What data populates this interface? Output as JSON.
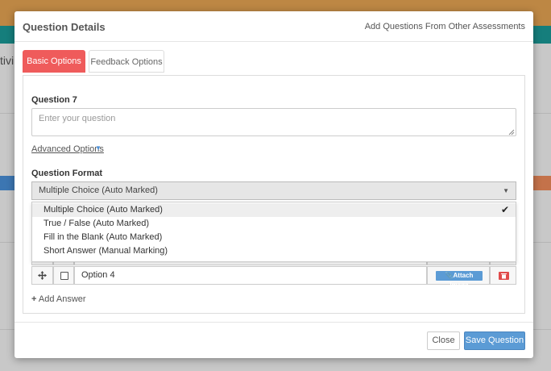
{
  "background": {
    "partial_text": "tivi"
  },
  "modal": {
    "title": "Question Details",
    "header_link": "Add Questions From Other Assessments",
    "tabs": [
      {
        "label": "Basic Options",
        "active": true
      },
      {
        "label": "Feedback Options",
        "active": false
      }
    ],
    "question_label": "Question 7",
    "question_placeholder": "Enter your question",
    "advanced_options": "Advanced Options",
    "format_label": "Question Format",
    "format_selected": "Multiple Choice (Auto Marked)",
    "format_options": [
      {
        "label": "Multiple Choice (Auto Marked)",
        "selected": true
      },
      {
        "label": "True / False (Auto Marked)",
        "selected": false
      },
      {
        "label": "Fill in the Blank (Auto Marked)",
        "selected": false
      },
      {
        "label": "Short Answer (Manual Marking)",
        "selected": false
      }
    ],
    "answers": [
      {
        "text": "Option 4",
        "attach_label": "Attach Image"
      }
    ],
    "add_answer": "Add Answer",
    "close_label": "Close",
    "save_label": "Save Question"
  },
  "colors": {
    "accent_red": "#ef5b5b",
    "primary_blue": "#5b9bd5",
    "topbar_orange": "#e7a553",
    "topbar_teal": "#1a9a98"
  },
  "icons": {
    "move": "move-icon",
    "check": "checkmark-icon",
    "caret": "caret-down-icon",
    "paperclip": "paperclip-icon",
    "trash": "trash-icon",
    "plus": "plus-icon"
  }
}
